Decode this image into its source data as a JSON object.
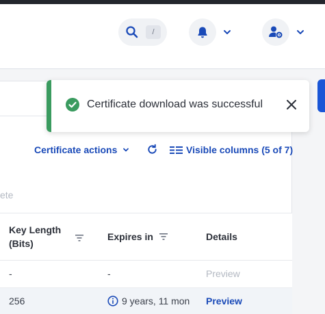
{
  "header": {
    "search_shortcut": "/",
    "icons": {
      "search": "search-icon",
      "notifications": "bell-icon",
      "user_settings": "user-gear-icon",
      "dropdown": "chevron-down-icon"
    }
  },
  "toast": {
    "message": "Certificate download was successful",
    "status": "success",
    "accent_color": "#3a9b5f"
  },
  "toolbar": {
    "certificate_actions": "Certificate actions",
    "visible_columns": "Visible columns (5 of 7)"
  },
  "filter_hint": "ete",
  "table": {
    "columns": [
      "Key Length (Bits)",
      "Expires in",
      "Details"
    ],
    "rows": [
      {
        "key_length": "-",
        "expires_in": "-",
        "details": "Preview",
        "details_enabled": false
      },
      {
        "key_length": "256",
        "expires_in": "9 years, 11 mon",
        "details": "Preview",
        "details_enabled": true
      }
    ]
  },
  "colors": {
    "link": "#1a4ab8",
    "accent": "#1a56d6",
    "disabled": "#b3b8c2"
  }
}
